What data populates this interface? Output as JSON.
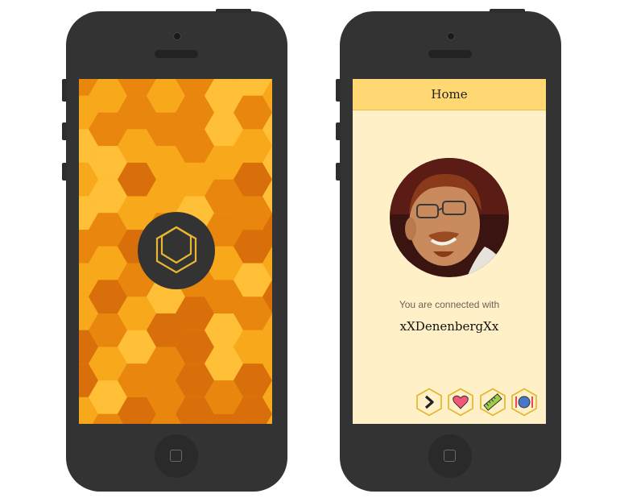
{
  "phones": [
    {
      "screen": "splash",
      "logo": {
        "icon": "hexagon-logo-icon",
        "color": "#e8b631"
      },
      "background_colors": [
        "#f7a81b",
        "#e8860e",
        "#ffbf36",
        "#d86f0a"
      ]
    },
    {
      "screen": "home",
      "header": {
        "title": "Home"
      },
      "profile": {
        "avatar": "profile-photo",
        "connected_label": "You are connected with",
        "username": "xXDenenbergXx"
      },
      "actions": [
        {
          "icon": "chevron-right-icon"
        },
        {
          "icon": "heart-icon"
        },
        {
          "icon": "ruler-icon"
        },
        {
          "icon": "plate-cutlery-icon"
        }
      ],
      "colors": {
        "header": "#ffd873",
        "background": "#fff0c8",
        "accent": "#e2b526"
      }
    }
  ]
}
